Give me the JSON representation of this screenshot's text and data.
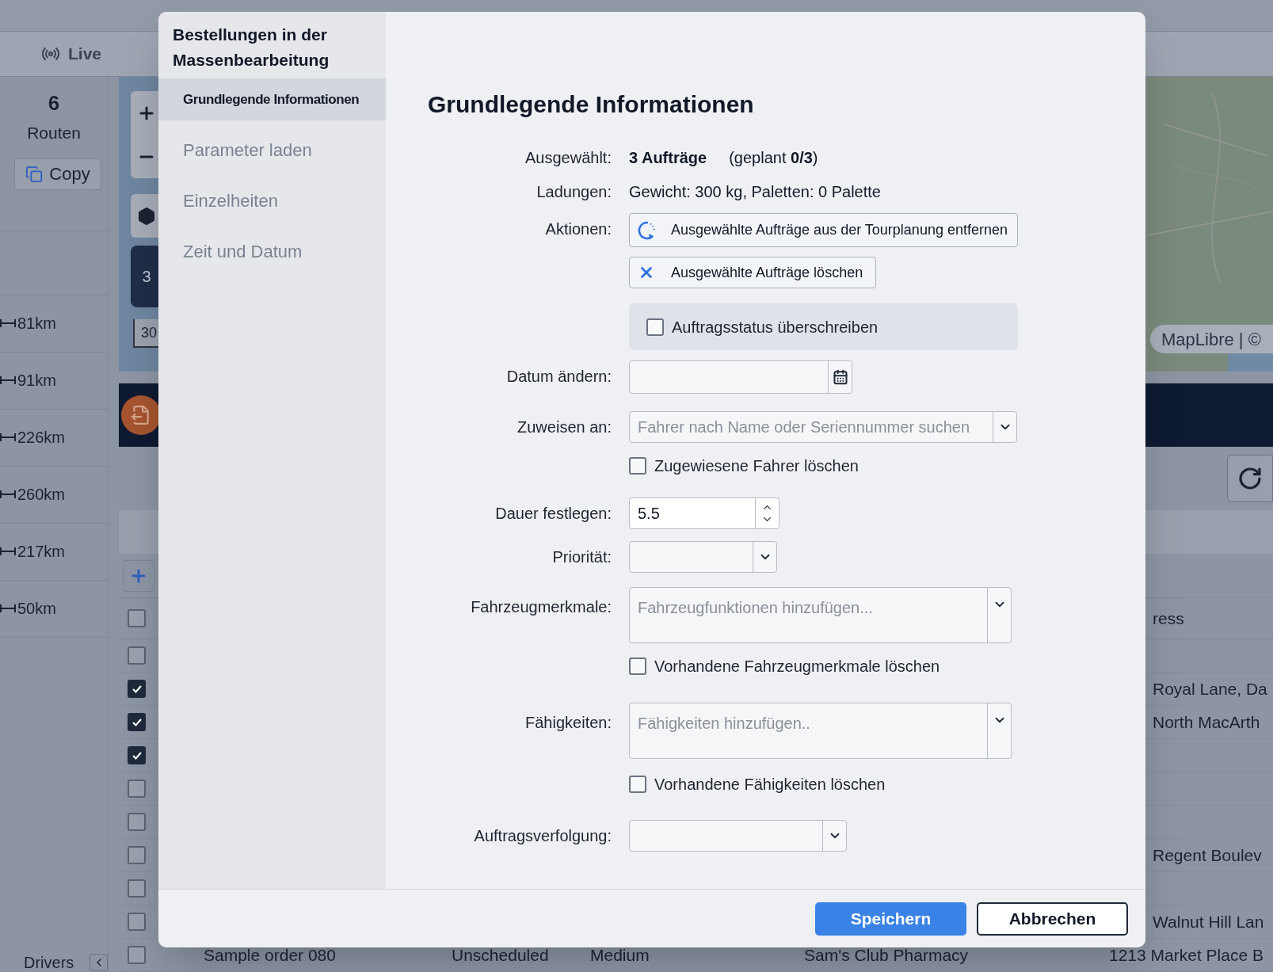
{
  "app": {
    "top": {
      "live": "Live"
    },
    "summary": {
      "count": "6",
      "label": "Routen",
      "copy": "Copy"
    },
    "routes": [
      {
        "distance": "81km"
      },
      {
        "distance": "91km"
      },
      {
        "distance": "226km"
      },
      {
        "distance": "260km"
      },
      {
        "distance": "217km"
      },
      {
        "distance": "50km"
      }
    ],
    "drivers": {
      "label": "Drivers"
    },
    "map": {
      "layer_count": "3",
      "scale": "30",
      "attribution": "MapLibre | ©"
    },
    "table": {
      "header": {
        "checked": false,
        "address": "ress"
      },
      "rows": [
        {
          "checked": false
        },
        {
          "checked": true,
          "address": "Royal Lane, Da"
        },
        {
          "checked": true,
          "address": "North MacArth"
        },
        {
          "checked": true
        },
        {
          "checked": false
        },
        {
          "checked": false
        },
        {
          "checked": false,
          "address": "Regent Boulev"
        },
        {
          "checked": false
        },
        {
          "checked": false,
          "address": "Walnut Hill Lan"
        },
        {
          "checked": false,
          "name": "Sample order 080",
          "status": "Unscheduled",
          "priority": "Medium",
          "customer": "Sam's Club Pharmacy",
          "address": "1213 Market Place B"
        }
      ]
    }
  },
  "dialog": {
    "title": "Bestellungen in der Massenbearbeitung",
    "nav": [
      {
        "label": "Grundlegende Informationen",
        "selected": true
      },
      {
        "label": "Parameter laden",
        "selected": false
      },
      {
        "label": "Einzelheiten",
        "selected": false
      },
      {
        "label": "Zeit und Datum",
        "selected": false
      }
    ],
    "heading": "Grundlegende Informationen",
    "fields": [
      {
        "kind": "summary",
        "label": "Ausgewählt:",
        "count": "3 Aufträge",
        "note": "(geplant **0/3**)"
      },
      {
        "kind": "text",
        "label": "Ladungen:",
        "value": "Gewicht: 300 kg, Paletten: 0 Palette"
      },
      {
        "kind": "actions",
        "label": "Aktionen:",
        "buttons": [
          {
            "label": "Ausgewählte Aufträge aus der Tourplanung entfernen"
          },
          {
            "label": "Ausgewählte Aufträge löschen"
          }
        ],
        "override": {
          "label": "Auftragsstatus überschreiben",
          "checked": false
        }
      },
      {
        "kind": "date",
        "label": "Datum ändern:"
      },
      {
        "kind": "select",
        "label": "Zuweisen an:",
        "placeholder": "Fahrer nach Name oder Seriennummer suchen",
        "clear": {
          "label": "Zugewiesene Fahrer löschen",
          "checked": false
        }
      },
      {
        "kind": "number",
        "label": "Dauer festlegen:",
        "value": "5.5"
      },
      {
        "kind": "select",
        "label": "Priorität:"
      },
      {
        "kind": "multiselect",
        "label": "Fahrzeugmerkmale:",
        "placeholder": "Fahrzeugfunktionen hinzufügen...",
        "clear": {
          "label": "Vorhandene Fahrzeugmerkmale löschen",
          "checked": false
        }
      },
      {
        "kind": "multiselect",
        "label": "Fähigkeiten:",
        "placeholder": "Fähigkeiten hinzufügen..",
        "clear": {
          "label": "Vorhandene Fähigkeiten löschen",
          "checked": false
        }
      },
      {
        "kind": "select",
        "label": "Auftragsverfolgung:"
      }
    ],
    "buttons": [
      {
        "kind": "primary",
        "label": "Speichern"
      },
      {
        "kind": "secondary",
        "label": "Abbrechen"
      }
    ]
  }
}
